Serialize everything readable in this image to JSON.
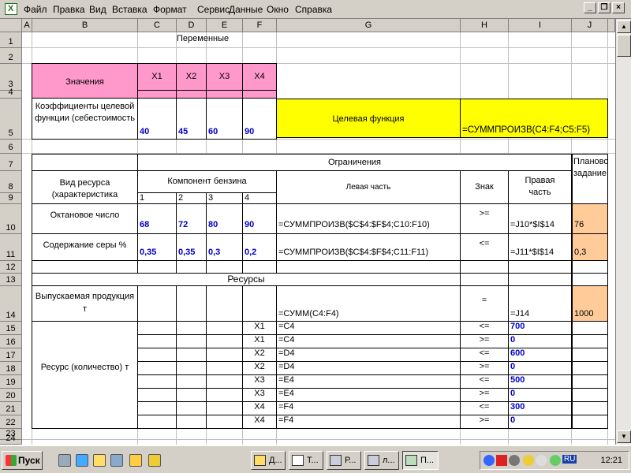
{
  "menubar": {
    "items": [
      "Файл",
      "Правка",
      "Вид",
      "Вставка",
      "Формат",
      "Сервис",
      "Данные",
      "Окно",
      "Справка"
    ],
    "win_buttons": [
      "_",
      "̱",
      "×"
    ]
  },
  "columns": [
    "A",
    "B",
    "C",
    "D",
    "E",
    "F",
    "G",
    "H",
    "I",
    "J"
  ],
  "rows": [
    "1",
    "2",
    "3",
    "4",
    "5",
    "6",
    "7",
    "8",
    "9",
    "10",
    "11",
    "12",
    "13",
    "14",
    "15",
    "16",
    "17",
    "18",
    "19",
    "20",
    "21",
    "22",
    "23",
    "24"
  ],
  "cells": {
    "c1": "Переменные",
    "b3": "Значения",
    "x1": "X1",
    "x2": "X2",
    "x3": "X3",
    "x4": "X4",
    "b5": "Коэффициенты целевой функции (себестоимость",
    "c5": "40",
    "d5": "45",
    "e5": "60",
    "f5": "90",
    "g5": "Целевая функция",
    "h5": "=СУММПРОИЗВ(C4:F4;C5:F5)",
    "g7": "Ограничения",
    "j7": "Плановое задание",
    "b8": "Вид ресурса (характеристика",
    "c8": "Компонент бензина",
    "g8": "Левая часть",
    "h8": "Знак",
    "i8": "Правая часть",
    "c9": "1",
    "d9": "2",
    "e9": "3",
    "f9": "4",
    "b10": "Октановое число",
    "c10": "68",
    "d10": "72",
    "e10": "80",
    "f10": "90",
    "g10": "=СУММПРОИЗВ($C$4:$F$4;C10:F10)",
    "h10": ">=",
    "i10": "=J10*$I$14",
    "j10": "76",
    "b11": "Содержание серы %",
    "c11": "0,35",
    "d11": "0,35",
    "e11": "0,3",
    "f11": "0,2",
    "g11": "=СУММПРОИЗВ($C$4:$F$4;C11:F11)",
    "h11": "<=",
    "i11": "=J11*$I$14",
    "j11": "0,3",
    "c13": "Ресурсы",
    "b14": "Выпускаемая продукция т",
    "g14": "=СУММ(C4:F4)",
    "h14": "=",
    "i14": "=J14",
    "j14": "1000",
    "b15": "Ресурс (количество) т",
    "res_rows": [
      {
        "f": "X1",
        "g": "=C4",
        "h": "<=",
        "i": "700"
      },
      {
        "f": "X1",
        "g": "=C4",
        "h": ">=",
        "i": "0"
      },
      {
        "f": "X2",
        "g": "=D4",
        "h": "<=",
        "i": "600"
      },
      {
        "f": "X2",
        "g": "=D4",
        "h": ">=",
        "i": "0"
      },
      {
        "f": "X3",
        "g": "=E4",
        "h": "<=",
        "i": "500"
      },
      {
        "f": "X3",
        "g": "=E4",
        "h": ">=",
        "i": "0"
      },
      {
        "f": "X4",
        "g": "=F4",
        "h": "<=",
        "i": "300"
      },
      {
        "f": "X4",
        "g": "=F4",
        "h": ">=",
        "i": "0"
      }
    ]
  },
  "taskbar": {
    "start": "Пуск",
    "buttons": [
      "Д...",
      "Т...",
      "Р...",
      "л...",
      "П..."
    ],
    "lang": "RU",
    "clock": "12:21"
  },
  "colors": {
    "pink": "#ff99cc",
    "yellow": "#ffff00",
    "peach": "#ffcc99",
    "blue_values": "#0000c8"
  }
}
